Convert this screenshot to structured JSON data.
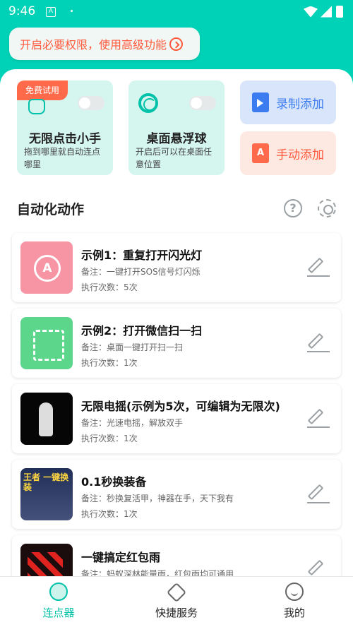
{
  "status_bar": {
    "time": "9:46",
    "notif_icon": "A"
  },
  "banner": {
    "text": "开启必要权限，使用高级功能"
  },
  "cards": {
    "clicker": {
      "tag": "免费试用",
      "title": "无限点击小手",
      "desc": "拖到哪里就自动连点哪里",
      "enabled": false
    },
    "float": {
      "title": "桌面悬浮球",
      "desc": "开启后可以在桌面任意位置",
      "enabled": false
    },
    "record_button": "录制添加",
    "manual_button": "手动添加",
    "manual_icon": "A"
  },
  "section": {
    "title": "自动化动作",
    "help": "?"
  },
  "actions": [
    {
      "title": "示例1：重复打开闪光灯",
      "note": "备注：一键打开SOS信号灯闪烁",
      "count": "执行次数：5次"
    },
    {
      "title": "示例2：打开微信扫一扫",
      "note": "备注：桌面一键打开扫一扫",
      "count": "执行次数：1次"
    },
    {
      "title": "无限电摇(示例为5次，可编辑为无限次)",
      "note": "备注：光速电摇，解放双手",
      "count": "执行次数：1次"
    },
    {
      "title": "0.1秒换装备",
      "note": "备注：秒换复活甲，神器在手，天下我有",
      "count": "执行次数：1次",
      "thumb_text": "王者 一键换装"
    },
    {
      "title": "一键搞定红包雨",
      "note": "备注：蚂蚁深林能量雨，红包雨均可通用",
      "count": ""
    }
  ],
  "bottom_nav": [
    {
      "label": "连点器",
      "active": true
    },
    {
      "label": "快捷服务",
      "active": false
    },
    {
      "label": "我的",
      "active": false
    }
  ],
  "colors": {
    "accent": "#00d2b7",
    "orange": "#ff5a3c",
    "blue": "#3b7cf0"
  }
}
